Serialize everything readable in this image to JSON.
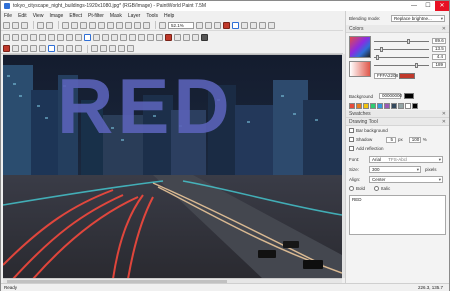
{
  "window": {
    "title": "tokyo_cityscape_night_buildings-1920x1080.jpg* (RGB/Image) - PaintWorld Paint 7.5M",
    "min": "—",
    "max": "☐",
    "close": "✕"
  },
  "menu": [
    "File",
    "Edit",
    "View",
    "Image",
    "Effect",
    "Pt-filter",
    "Mask",
    "Layer",
    "Tools",
    "Help"
  ],
  "toolbar": {
    "zoom": "52.1%"
  },
  "canvas": {
    "overlay_text": "RED"
  },
  "status": {
    "left": "Ready",
    "coords": "226.3, 135.7"
  },
  "panel": {
    "blending_label": "Blending mode:",
    "blending_value": "Replace brightne...",
    "colors_title": "Colors",
    "color_values": [
      "89.6",
      "13.5",
      "4.4",
      "189"
    ],
    "hex_value": "FFFA2208",
    "background_label": "Background",
    "background_value": "00000000",
    "swatches_title": "Swatches",
    "drawing_tool_title": "Drawing Tool",
    "opt_bar_background": "Bar background",
    "opt_shadow": "Shadow",
    "shadow_size": "5",
    "shadow_unit": "px",
    "shadow_opacity": "100",
    "shadow_pct": "%",
    "opt_add_reflection": "Add reflection",
    "font_label": "Font:",
    "font_value": "Arial",
    "font_style": "TFS-Abcl",
    "size_label": "Size:",
    "size_value": "300",
    "size_unit": "pixels",
    "align_label": "Align:",
    "align_value": "Center",
    "bold_label": "Bold",
    "italic_label": "Italic",
    "text_value": "RED"
  },
  "colors": {
    "accent": "#2f6fd6",
    "primary_swatch": "#c0392b",
    "background_swatch": "#000000"
  }
}
